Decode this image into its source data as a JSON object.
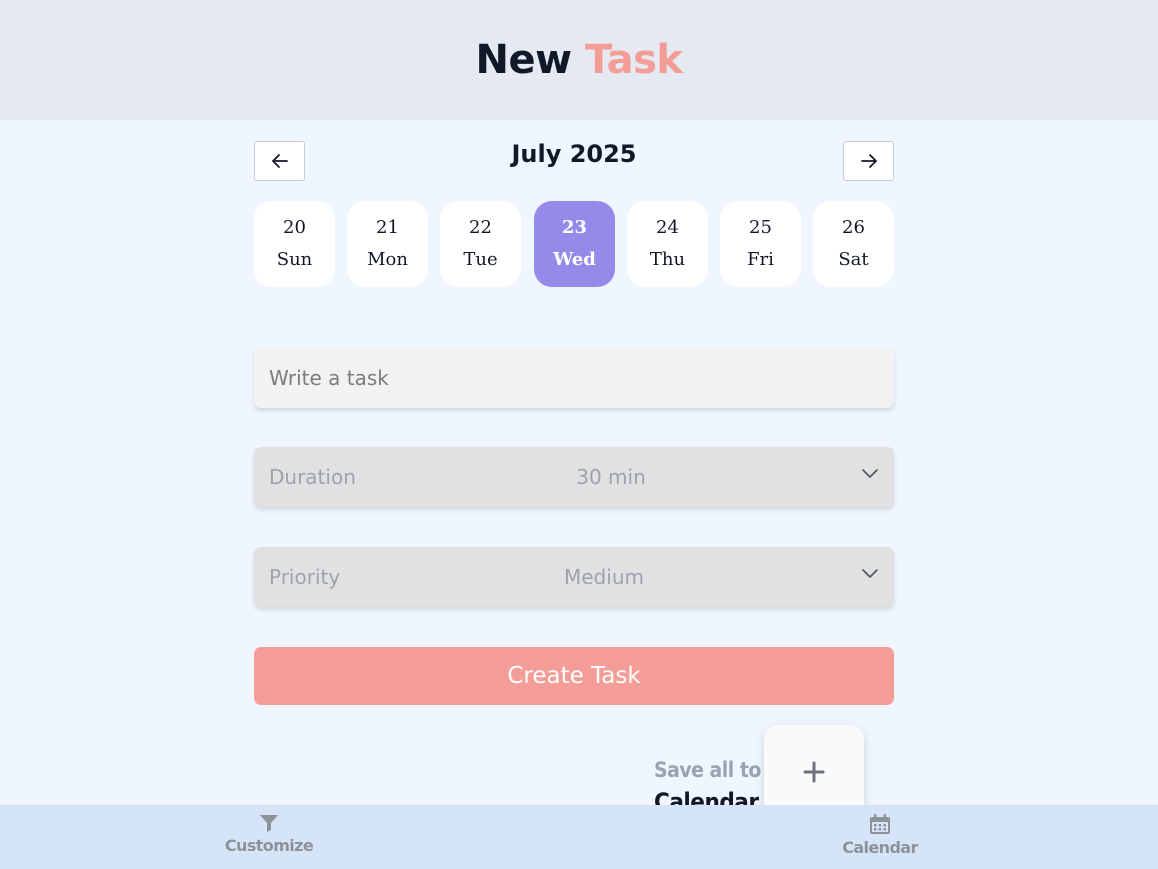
{
  "header": {
    "title_part1": "New",
    "title_part2": "Task"
  },
  "calendar": {
    "month_label": "July 2025",
    "days": [
      {
        "num": "20",
        "weekday": "Sun"
      },
      {
        "num": "21",
        "weekday": "Mon"
      },
      {
        "num": "22",
        "weekday": "Tue"
      },
      {
        "num": "23",
        "weekday": "Wed",
        "selected": true
      },
      {
        "num": "24",
        "weekday": "Thu"
      },
      {
        "num": "25",
        "weekday": "Fri"
      },
      {
        "num": "26",
        "weekday": "Sat"
      }
    ]
  },
  "form": {
    "task_placeholder": "Write a task",
    "task_value": "",
    "duration_label": "Duration",
    "duration_value": "30 min",
    "priority_label": "Priority",
    "priority_value": "Medium",
    "create_label": "Create Task"
  },
  "save": {
    "line1": "Save all to",
    "line2": "Calendar",
    "fab_icon": "plus-icon"
  },
  "bottom_nav": {
    "customize_label": "Customize",
    "calendar_label": "Calendar"
  },
  "colors": {
    "accent": "#948aea",
    "brand_pink": "#f49d97",
    "nav_bg": "#d6e4f7"
  }
}
